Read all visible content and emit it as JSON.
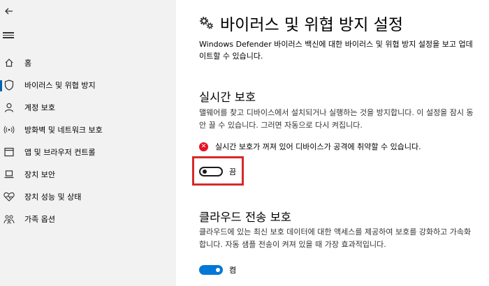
{
  "sidebar": {
    "items": [
      {
        "label": "홈",
        "icon": "home-icon"
      },
      {
        "label": "바이러스 및 위협 방지",
        "icon": "shield-icon"
      },
      {
        "label": "계정 보호",
        "icon": "person-icon"
      },
      {
        "label": "방화벽 및 네트워크 보호",
        "icon": "wifi-icon"
      },
      {
        "label": "앱 및 브라우저 컨트롤",
        "icon": "browser-icon"
      },
      {
        "label": "장치 보안",
        "icon": "laptop-icon"
      },
      {
        "label": "장치 성능 및 상태",
        "icon": "heart-icon"
      },
      {
        "label": "가족 옵션",
        "icon": "family-icon"
      }
    ],
    "selected_index": 1
  },
  "main": {
    "title": "바이러스 및 위협 방지 설정",
    "intro": "Windows Defender 바이러스 백신에 대한 바이러스 및 위협 방지 설정을 보고 업데이트할 수 있습니다.",
    "realtime": {
      "title": "실시간 보호",
      "description": "맬웨어를 찾고 디바이스에서 설치되거나 실행하는 것을 방지합니다. 이 설정을 잠시 동안 끌 수 있습니다. 그러면 자동으로 다시 켜집니다.",
      "warning": "실시간 보호가 꺼져 있어 디바이스가 공격에 취약할 수 있습니다.",
      "toggle_state": "off",
      "toggle_label": "끔"
    },
    "cloud": {
      "title": "클라우드 전송 보호",
      "description": "클라우드에 있는 최신 보호 데이터에 대한 액세스를 제공하여 보호를 강화하고 가속화합니다. 자동 샘플 전송이 켜져 있을 때 가장 효과적입니다.",
      "toggle_state": "on",
      "toggle_label": "켬"
    }
  },
  "colors": {
    "accent": "#0078d7",
    "warning": "#e81123",
    "highlight_box": "#d42a2a",
    "sidebar_bg": "#f2f2f2"
  }
}
